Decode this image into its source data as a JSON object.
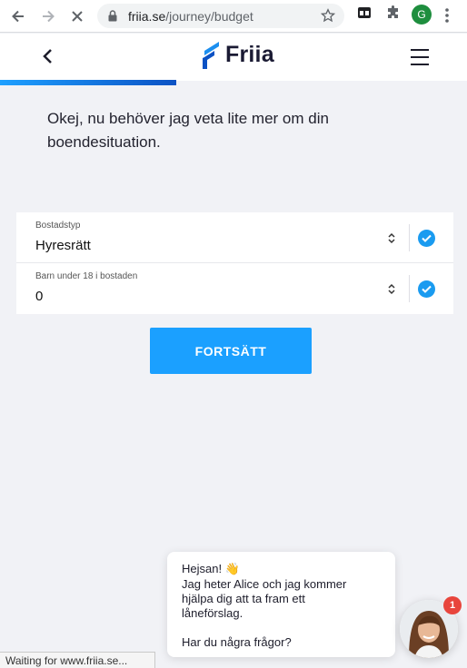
{
  "browser": {
    "url_host": "friia.se",
    "url_path": "/journey/budget",
    "profile_initial": "G"
  },
  "header": {
    "logo_text": "Friia"
  },
  "question": "Okej, nu behöver jag veta lite mer om din boendesituation.",
  "form": {
    "fields": [
      {
        "label": "Bostadstyp",
        "value": "Hyresrätt"
      },
      {
        "label": "Barn under 18 i bostaden",
        "value": "0"
      }
    ]
  },
  "cta_label": "FORTSÄTT",
  "chat": {
    "greeting": "Hejsan! 👋",
    "line1": "Jag heter Alice och jag kommer",
    "line2": "hjälpa dig att ta fram ett",
    "line3": "låneförslag.",
    "question": "Har du några frågor?",
    "badge_count": "1"
  },
  "status_text": "Waiting for www.friia.se...",
  "colors": {
    "accent": "#1ba0ff",
    "check": "#1a9bf0",
    "badge": "#e8453c",
    "progress_from": "#1ea0ff",
    "progress_to": "#0c52c4"
  }
}
